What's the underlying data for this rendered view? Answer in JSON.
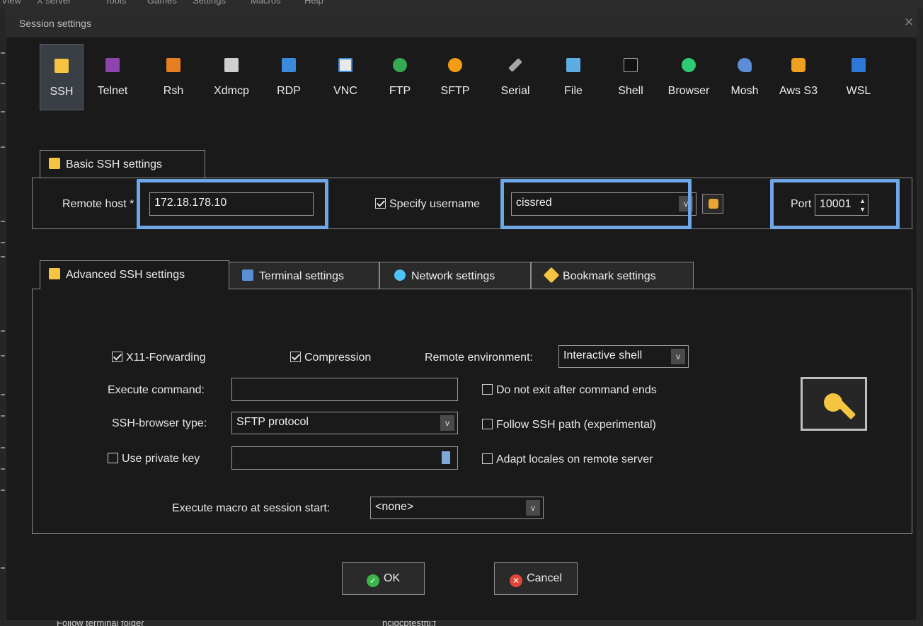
{
  "background": {
    "menu_items": [
      "View",
      "X server",
      "Tools",
      "Games",
      "Settings",
      "Macros",
      "Help"
    ],
    "bottom_text": [
      "Follow terminal folder",
      "ncidcptestftl:f"
    ]
  },
  "dialog": {
    "title": "Session settings",
    "close_icon": "close-icon"
  },
  "protocols": [
    {
      "id": "ssh",
      "label": "SSH",
      "icon": "ssh-key-icon"
    },
    {
      "id": "telnet",
      "label": "Telnet",
      "icon": "telnet-icon"
    },
    {
      "id": "rsh",
      "label": "Rsh",
      "icon": "rsh-icon"
    },
    {
      "id": "xdmcp",
      "label": "Xdmcp",
      "icon": "xdmcp-icon"
    },
    {
      "id": "rdp",
      "label": "RDP",
      "icon": "rdp-icon"
    },
    {
      "id": "vnc",
      "label": "VNC",
      "icon": "vnc-icon"
    },
    {
      "id": "ftp",
      "label": "FTP",
      "icon": "ftp-globe-icon"
    },
    {
      "id": "sftp",
      "label": "SFTP",
      "icon": "sftp-globe-icon"
    },
    {
      "id": "serial",
      "label": "Serial",
      "icon": "serial-cable-icon"
    },
    {
      "id": "file",
      "label": "File",
      "icon": "file-monitor-icon"
    },
    {
      "id": "shell",
      "label": "Shell",
      "icon": "shell-terminal-icon"
    },
    {
      "id": "browser",
      "label": "Browser",
      "icon": "browser-globe-icon"
    },
    {
      "id": "mosh",
      "label": "Mosh",
      "icon": "mosh-satellite-icon"
    },
    {
      "id": "aws",
      "label": "Aws S3",
      "icon": "aws-cubes-icon"
    },
    {
      "id": "wsl",
      "label": "WSL",
      "icon": "wsl-windows-icon"
    }
  ],
  "selected_protocol": "SSH",
  "basic": {
    "tab_label": "Basic SSH settings",
    "remote_host_label": "Remote host",
    "required_mark": "*",
    "remote_host_value": "172.18.178.10",
    "specify_username_label": "Specify username",
    "specify_username_checked": true,
    "username_value": "cissred",
    "port_label": "Port",
    "port_value": "10001"
  },
  "tabs": [
    {
      "label": "Advanced SSH settings",
      "active": true
    },
    {
      "label": "Terminal settings",
      "active": false
    },
    {
      "label": "Network settings",
      "active": false
    },
    {
      "label": "Bookmark settings",
      "active": false
    }
  ],
  "advanced": {
    "x11_label": "X11-Forwarding",
    "x11_checked": true,
    "compression_label": "Compression",
    "compression_checked": true,
    "remote_env_label": "Remote environment:",
    "remote_env_value": "Interactive shell",
    "exec_cmd_label": "Execute command:",
    "exec_cmd_value": "",
    "no_exit_label": "Do not exit after command ends",
    "no_exit_checked": false,
    "browser_type_label": "SSH-browser type:",
    "browser_type_value": "SFTP protocol",
    "follow_path_label": "Follow SSH path (experimental)",
    "follow_path_checked": false,
    "private_key_label": "Use private key",
    "private_key_checked": false,
    "private_key_value": "",
    "adapt_locales_label": "Adapt locales on remote server",
    "adapt_locales_checked": false,
    "macro_label": "Execute macro at session start:",
    "macro_value": "<none>"
  },
  "buttons": {
    "ok": "OK",
    "cancel": "Cancel"
  },
  "colors": {
    "highlight": "#6ea6e8",
    "dialog_bg": "#1a1a1a",
    "ok_icon": "#3bb54a",
    "cancel_icon": "#e0453a"
  }
}
